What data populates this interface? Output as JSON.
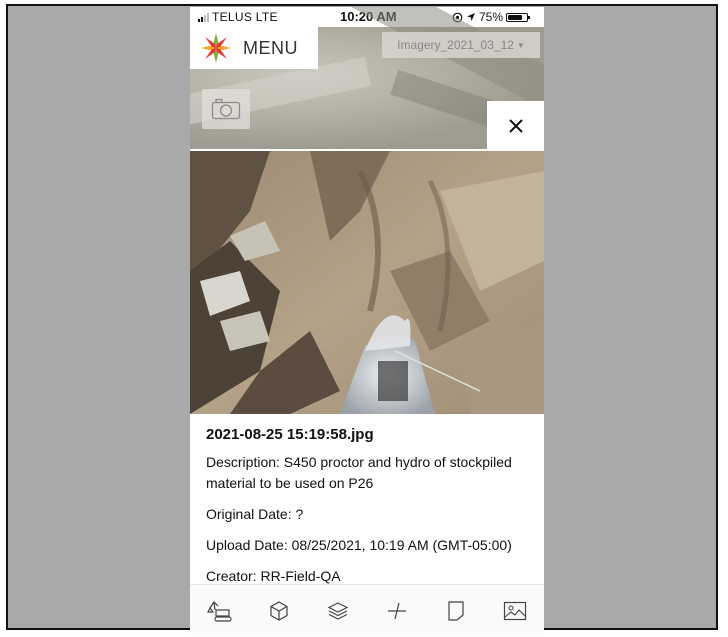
{
  "status_bar": {
    "carrier": "TELUS  LTE",
    "time": "10:20 AM",
    "battery": "75%",
    "battery_level": 0.75
  },
  "header": {
    "menu_label": "MENU",
    "imagery_selected": "Imagery_2021_03_12"
  },
  "photo_panel": {
    "filename": "2021-08-25 15:19:58.jpg",
    "description": "Description: S450 proctor and hydro of stockpiled material to be used on P26",
    "original_date": "Original Date: ?",
    "upload_date": "Upload Date: 08/25/2021, 10:19 AM (GMT-05:00)",
    "creator": "Creator: RR-Field-QA"
  },
  "toolbar": {
    "items": [
      "excavator-icon",
      "cube-icon",
      "layers-icon",
      "measure-icon",
      "document-icon",
      "image-icon"
    ]
  },
  "colors": {
    "frame_bg": "#a9a9a9",
    "logo_green": "#7cb342",
    "logo_red": "#e53935",
    "logo_yellow": "#f9a825"
  }
}
